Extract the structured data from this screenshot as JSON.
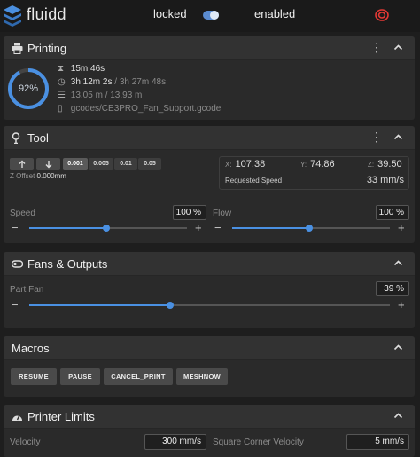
{
  "app": {
    "brand": "fluidd"
  },
  "topbar": {
    "locked_label": "locked",
    "enabled_label": "enabled"
  },
  "colors": {
    "accent": "#4a90e2",
    "brand": "#4a8fe0",
    "estop": "#e53935",
    "card": "#2a2a2a",
    "card_header": "#323232",
    "page": "#1e1e1e"
  },
  "printing": {
    "title": "Printing",
    "progress_label": "92%",
    "progress_fraction": 0.92,
    "elapsed": "15m 46s",
    "remaining": "3h 12m 2s",
    "total": "/ 3h 27m 48s",
    "filament": "13.05 m / 13.93 m",
    "file": "gcodes/CE3PRO_Fan_Support.gcode"
  },
  "tool": {
    "title": "Tool",
    "z_up_icon": "arrow-up-icon",
    "z_down_icon": "arrow-down-icon",
    "z_steps": [
      "0.001",
      "0.005",
      "0.01",
      "0.05"
    ],
    "z_step_active": 0,
    "z_offset_label": "Z Offset",
    "z_offset_value": "0.000mm",
    "x_label": "X:",
    "x_value": "107.38",
    "y_label": "Y:",
    "y_value": "74.86",
    "z_label": "Z:",
    "z_value": "39.50",
    "requested_speed_label": "Requested Speed",
    "requested_speed_value": "33 mm/s",
    "speed_label": "Speed",
    "speed_value": "100 %",
    "speed_fraction": 0.49,
    "flow_label": "Flow",
    "flow_value": "100 %",
    "flow_fraction": 0.49
  },
  "fans": {
    "title": "Fans & Outputs",
    "part_fan_label": "Part Fan",
    "part_fan_value": "39 %",
    "part_fan_fraction": 0.39
  },
  "macros": {
    "title": "Macros",
    "buttons": [
      "RESUME",
      "PAUSE",
      "CANCEL_PRINT",
      "MESHNOW"
    ]
  },
  "limits": {
    "title": "Printer Limits",
    "velocity_label": "Velocity",
    "velocity_value": "300 mm/s",
    "scv_label": "Square Corner Velocity",
    "scv_value": "5 mm/s"
  },
  "glyphs": {
    "minus": "−",
    "plus": "+",
    "dots": "⋮"
  }
}
